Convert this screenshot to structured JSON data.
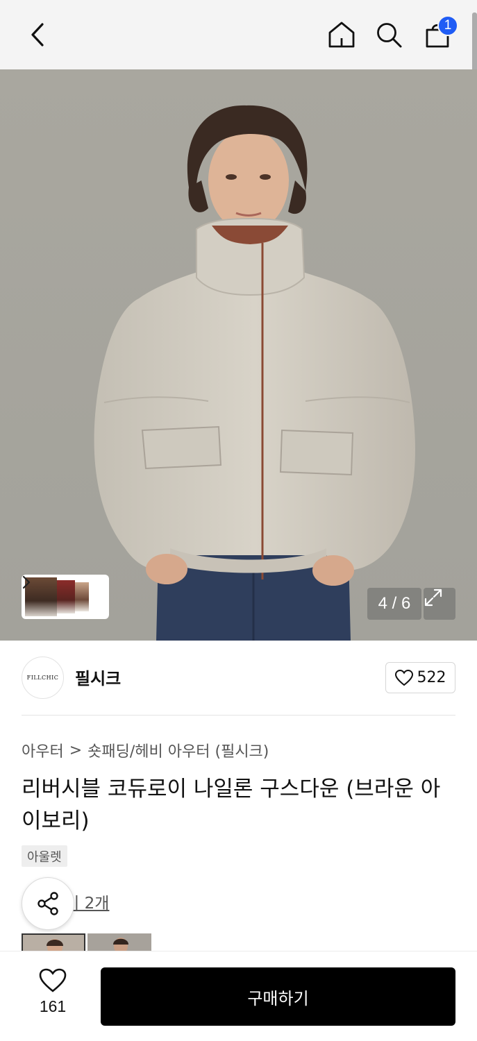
{
  "header": {
    "icons": [
      "back-icon",
      "home-icon",
      "search-icon",
      "shopping-bag-icon"
    ],
    "cart_count": "1"
  },
  "gallery": {
    "counter": "4 / 6",
    "icons": [
      "chevron-right-icon",
      "expand-icon"
    ]
  },
  "brand": {
    "logo_text": "FILLCHIC",
    "name": "필시크",
    "like_count": "522"
  },
  "breadcrumb": {
    "level1": "아우터",
    "separator": ">",
    "level2": "숏패딩/헤비 아우터 (필시크)"
  },
  "product": {
    "title": "리버시블 코듀로이 나일론 구스다운 (브라운 아이보리)",
    "tag": "아울렛"
  },
  "reviews": {
    "link_text": "후기 2개"
  },
  "bottom_bar": {
    "wish_count": "161",
    "buy_label": "구매하기"
  },
  "colors": {
    "accent_badge": "#1f5cf5",
    "buy_button": "#000000",
    "hero_background": "#a8a69f"
  }
}
